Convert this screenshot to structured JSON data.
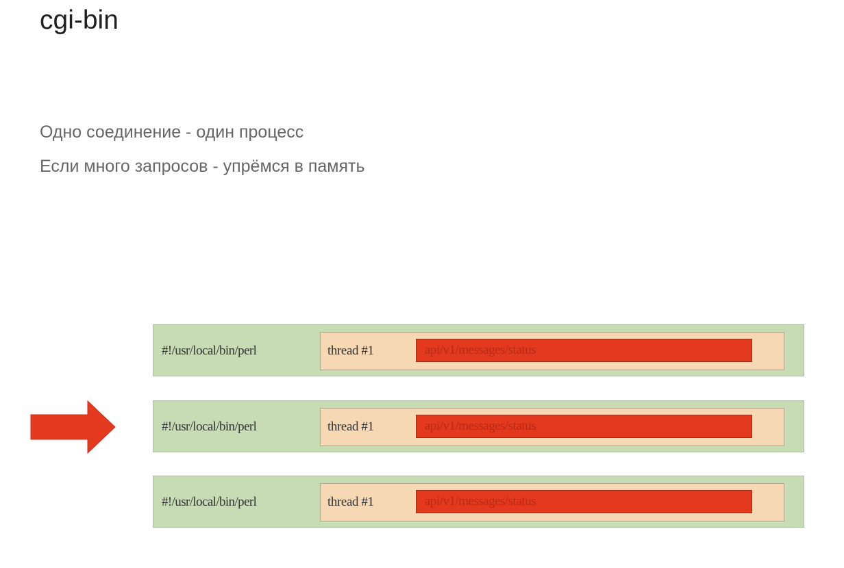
{
  "slide": {
    "title": "cgi-bin",
    "bullets": [
      "Одно соединение - один процесс",
      "Если много запросов - упрёмся в память"
    ]
  },
  "diagram": {
    "processes": [
      {
        "label": "#!/usr/local/bin/perl",
        "thread": {
          "label": "thread #1",
          "request": "api/v1/messages/status"
        },
        "highlighted": false
      },
      {
        "label": "#!/usr/local/bin/perl",
        "thread": {
          "label": "thread #1",
          "request": "api/v1/messages/status"
        },
        "highlighted": true
      },
      {
        "label": "#!/usr/local/bin/perl",
        "thread": {
          "label": "thread #1",
          "request": "api/v1/messages/status"
        },
        "highlighted": false
      }
    ],
    "pointer": {
      "icon": "right-arrow-icon",
      "target_index": 1
    },
    "colors": {
      "process_fill": "#c7dcb5",
      "thread_fill": "#f6d8b4",
      "request_fill": "#e2391f",
      "arrow_fill": "#e2391f"
    }
  }
}
